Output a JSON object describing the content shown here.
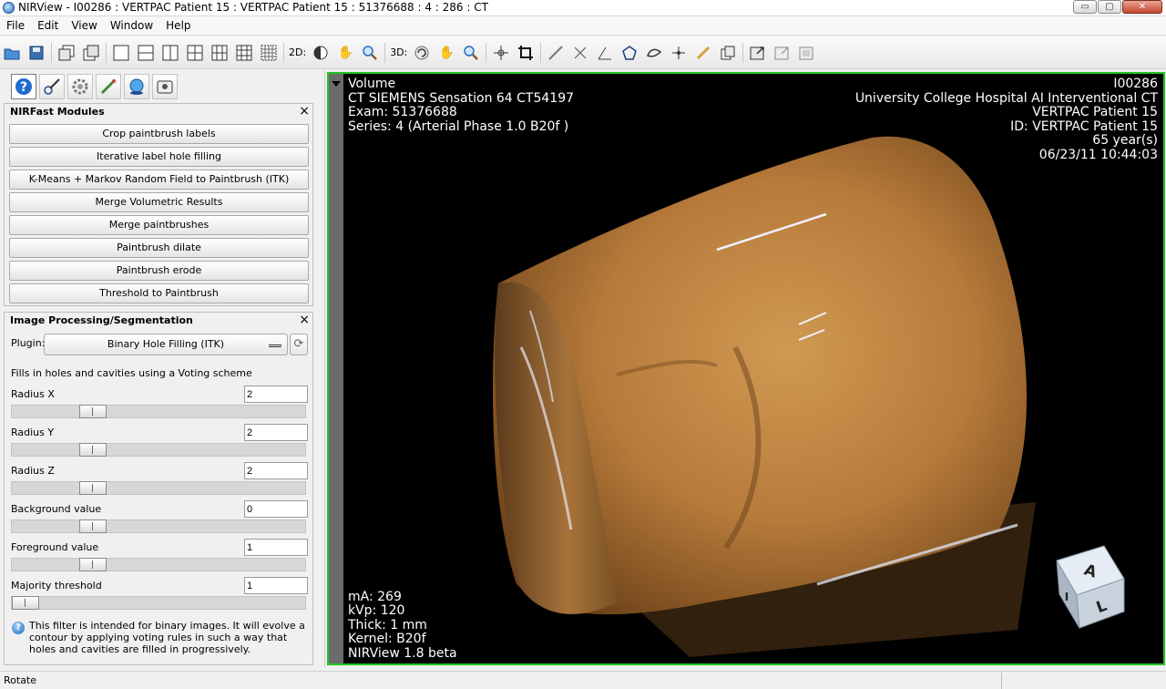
{
  "window": {
    "title": "NIRView - I00286 : VERTPAC Patient 15 : VERTPAC Patient 15 : 51376688 : 4  : 286  : CT",
    "minimize": "▭",
    "maximize": "▢",
    "close": "✕"
  },
  "menu": [
    "File",
    "Edit",
    "View",
    "Window",
    "Help"
  ],
  "toolbar": {
    "label_2d": "2D:",
    "label_3d": "3D:"
  },
  "tabs": [
    {
      "icon": "help-icon",
      "glyph": "?"
    },
    {
      "icon": "roi-tools-icon",
      "glyph": "✎"
    },
    {
      "icon": "settings-icon",
      "glyph": "⚙"
    },
    {
      "icon": "probe-icon",
      "glyph": "⚒"
    },
    {
      "icon": "globe-icon",
      "glyph": "◉"
    },
    {
      "icon": "snapshot-icon",
      "glyph": "▣"
    }
  ],
  "modules": {
    "title": "NIRFast Modules",
    "close": "×",
    "buttons": [
      "Crop paintbrush labels",
      "Iterative label hole filling",
      "K-Means + Markov Random Field to Paintbrush (ITK)",
      "Merge Volumetric Results",
      "Merge paintbrushes",
      "Paintbrush dilate",
      "Paintbrush erode",
      "Threshold to Paintbrush"
    ]
  },
  "segmentation": {
    "title": "Image Processing/Segmentation",
    "close": "×",
    "plugin_label": "Plugin:",
    "plugin_value": "Binary Hole Filling (ITK)",
    "description": "Fills in holes and cavities using a Voting scheme",
    "params": [
      {
        "label": "Radius X",
        "value": "2"
      },
      {
        "label": "Radius Y",
        "value": "2"
      },
      {
        "label": "Radius Z",
        "value": "2"
      },
      {
        "label": "Background value",
        "value": "0"
      },
      {
        "label": "Foreground value",
        "value": "1"
      },
      {
        "label": "Majority threshold",
        "value": "1"
      }
    ],
    "info": "This filter is intended for binary images. It will evolve a contour by applying voting rules in such a way that holes and cavities are filled in progressively."
  },
  "viewer": {
    "top_left": [
      "Volume",
      "CT SIEMENS Sensation 64 CT54197",
      "Exam: 51376688",
      "Series: 4  (Arterial Phase  1.0  B20f )"
    ],
    "top_right": [
      "I00286",
      "University College Hospital  AI Interventional CT",
      "VERTPAC Patient 15",
      "ID: VERTPAC Patient 15",
      "65 year(s)",
      "06/23/11 10:44:03"
    ],
    "bottom_left": [
      "mA: 269",
      "kVp: 120",
      "Thick: 1 mm",
      "Kernel: B20f",
      "NIRView 1.8 beta"
    ],
    "cube_letters": [
      "A",
      "L",
      "I"
    ],
    "accent_border": "#22c522"
  },
  "status": {
    "text": "Rotate"
  }
}
